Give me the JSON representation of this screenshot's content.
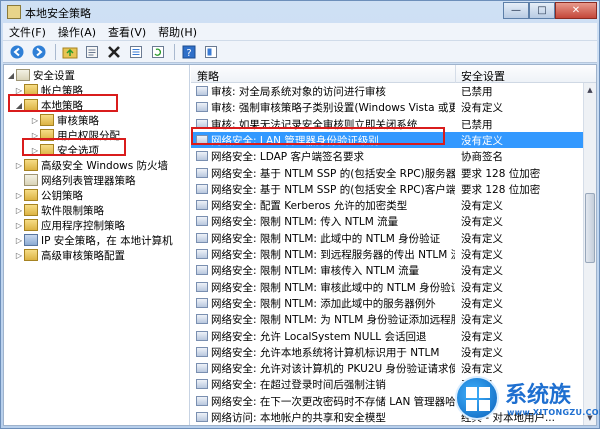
{
  "window": {
    "title": "本地安全策略",
    "btn_min": "—",
    "btn_max": "□",
    "btn_close": "✕"
  },
  "menu": [
    "文件(F)",
    "操作(A)",
    "查看(V)",
    "帮助(H)"
  ],
  "toolbar": {
    "icons": [
      "back-icon",
      "forward-icon",
      "up-folder-icon",
      "properties-icon",
      "delete-icon",
      "export-list-icon",
      "refresh-icon",
      "help-icon",
      "show-console-icon"
    ]
  },
  "tree": {
    "items": [
      {
        "label": "安全设置",
        "icon": "doc"
      },
      {
        "label": "帐户策略",
        "icon": "folder"
      },
      {
        "label": "本地策略",
        "icon": "folder"
      },
      {
        "label": "审核策略",
        "icon": "folder"
      },
      {
        "label": "用户权限分配",
        "icon": "folder"
      },
      {
        "label": "安全选项",
        "icon": "folder"
      },
      {
        "label": "高级安全 Windows 防火墙",
        "icon": "folder"
      },
      {
        "label": "网络列表管理器策略",
        "icon": "doc"
      },
      {
        "label": "公钥策略",
        "icon": "folder"
      },
      {
        "label": "软件限制策略",
        "icon": "folder"
      },
      {
        "label": "应用程序控制策略",
        "icon": "folder"
      },
      {
        "label": "IP 安全策略，在 本地计算机",
        "icon": "net"
      },
      {
        "label": "高级审核策略配置",
        "icon": "folder"
      }
    ]
  },
  "list": {
    "col_policy": "策略",
    "col_setting": "安全设置",
    "rows": [
      {
        "policy": "审核: 对全局系统对象的访问进行审核",
        "setting": "已禁用"
      },
      {
        "policy": "审核: 强制审核策略子类别设置(Windows Vista 或更高版本)以覆盖审核策略类别设置",
        "setting": "没有定义"
      },
      {
        "policy": "审核: 如果无法记录安全审核则立即关闭系统",
        "setting": "已禁用"
      },
      {
        "policy": "网络安全: LAN 管理器身份验证级别",
        "setting": "没有定义"
      },
      {
        "policy": "网络安全: LDAP 客户端签名要求",
        "setting": "协商签名"
      },
      {
        "policy": "网络安全: 基于 NTLM SSP 的(包括安全 RPC)服务器的最小会话安全",
        "setting": "要求 128 位加密"
      },
      {
        "policy": "网络安全: 基于 NTLM SSP 的(包括安全 RPC)客户端的最小会话安全",
        "setting": "要求 128 位加密"
      },
      {
        "policy": "网络安全: 配置 Kerberos 允许的加密类型",
        "setting": "没有定义"
      },
      {
        "policy": "网络安全: 限制 NTLM: 传入 NTLM 流量",
        "setting": "没有定义"
      },
      {
        "policy": "网络安全: 限制 NTLM: 此域中的 NTLM 身份验证",
        "setting": "没有定义"
      },
      {
        "policy": "网络安全: 限制 NTLM: 到远程服务器的传出 NTLM 流量",
        "setting": "没有定义"
      },
      {
        "policy": "网络安全: 限制 NTLM: 审核传入 NTLM 流量",
        "setting": "没有定义"
      },
      {
        "policy": "网络安全: 限制 NTLM: 审核此域中的 NTLM 身份验证",
        "setting": "没有定义"
      },
      {
        "policy": "网络安全: 限制 NTLM: 添加此域中的服务器例外",
        "setting": "没有定义"
      },
      {
        "policy": "网络安全: 限制 NTLM: 为 NTLM 身份验证添加远程服务器例外",
        "setting": "没有定义"
      },
      {
        "policy": "网络安全: 允许 LocalSystem NULL 会话回退",
        "setting": "没有定义"
      },
      {
        "policy": "网络安全: 允许本地系统将计算机标识用于 NTLM",
        "setting": "没有定义"
      },
      {
        "policy": "网络安全: 允许对该计算机的 PKU2U 身份验证请求使用联机标识",
        "setting": "没有定义"
      },
      {
        "policy": "网络安全: 在超过登录时间后强制注销",
        "setting": "已禁用"
      },
      {
        "policy": "网络安全: 在下一次更改密码时不存储 LAN 管理器哈希值",
        "setting": "已启用"
      },
      {
        "policy": "网络访问: 本地帐户的共享和安全模型",
        "setting": "经典 - 对本地用户..."
      }
    ]
  },
  "watermark": {
    "brand": "系统族",
    "url": "www.XITONGZU.COM"
  }
}
